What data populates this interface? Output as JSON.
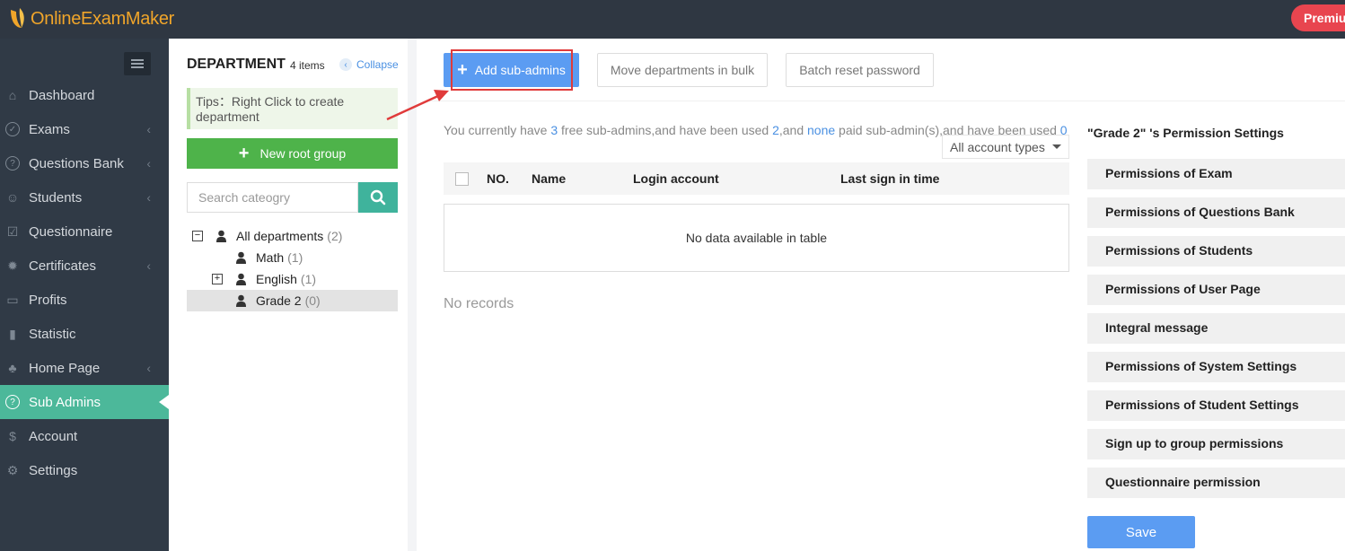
{
  "brand": {
    "logo_text": "OnlineExamMaker",
    "premium": "Premium"
  },
  "sidebar": {
    "items": [
      {
        "label": "Dashboard",
        "icon": "home-icon",
        "chevron": false
      },
      {
        "label": "Exams",
        "icon": "check-circle-icon",
        "chevron": true
      },
      {
        "label": "Questions Bank",
        "icon": "question-circle-icon",
        "chevron": true
      },
      {
        "label": "Students",
        "icon": "students-icon",
        "chevron": true
      },
      {
        "label": "Questionnaire",
        "icon": "checkbox-icon",
        "chevron": false
      },
      {
        "label": "Certificates",
        "icon": "gear-badge-icon",
        "chevron": true
      },
      {
        "label": "Profits",
        "icon": "card-icon",
        "chevron": false
      },
      {
        "label": "Statistic",
        "icon": "bar-chart-icon",
        "chevron": false
      },
      {
        "label": "Home Page",
        "icon": "leaf-icon",
        "chevron": true
      },
      {
        "label": "Sub Admins",
        "icon": "question-circle-icon",
        "chevron": false,
        "active": true
      },
      {
        "label": "Account",
        "icon": "dollar-icon",
        "chevron": false
      },
      {
        "label": "Settings",
        "icon": "gear-icon",
        "chevron": false
      }
    ]
  },
  "department": {
    "title": "DEPARTMENT",
    "count": "4 items",
    "collapse": "Collapse",
    "tips": "Tips：Right Click to create department",
    "new_root": "New root group",
    "search_placeholder": "Search cateogry",
    "tree": [
      {
        "label": "All departments",
        "count": "(2)",
        "toggle": "−"
      },
      {
        "label": "Math",
        "count": "(1)"
      },
      {
        "label": "English",
        "count": "(1)",
        "toggle": "+"
      },
      {
        "label": "Grade 2",
        "count": "(0)",
        "selected": true
      }
    ]
  },
  "toolbar": {
    "add_sub_admins": "Add sub-admins",
    "move_departments": "Move departments in bulk",
    "batch_reset": "Batch reset password"
  },
  "info": {
    "p1": "You currently have ",
    "free": "3",
    "p2": " free sub-admins,and have been used ",
    "used": "2",
    "p3": ",and ",
    "paid": "none",
    "p4": " paid sub-admin(s),and have been used ",
    "paid_used": "0"
  },
  "account_filter": "All account types",
  "table": {
    "columns": [
      "NO.",
      "Name",
      "Login account",
      "Last sign in time"
    ],
    "empty": "No data available in table"
  },
  "no_records": "No records",
  "permissions": {
    "title": "\"Grade 2\" 's Permission Settings",
    "items": [
      "Permissions of Exam",
      "Permissions of Questions Bank",
      "Permissions of Students",
      "Permissions of User Page",
      "Integral message",
      "Permissions of System Settings",
      "Permissions of Student Settings",
      "Sign up to group permissions",
      "Questionnaire permission"
    ],
    "save": "Save"
  },
  "colors": {
    "accent": "#4cb89a",
    "primary": "#5b9cf2",
    "highlight": "#e03b3b",
    "sidebar": "#303a46"
  }
}
